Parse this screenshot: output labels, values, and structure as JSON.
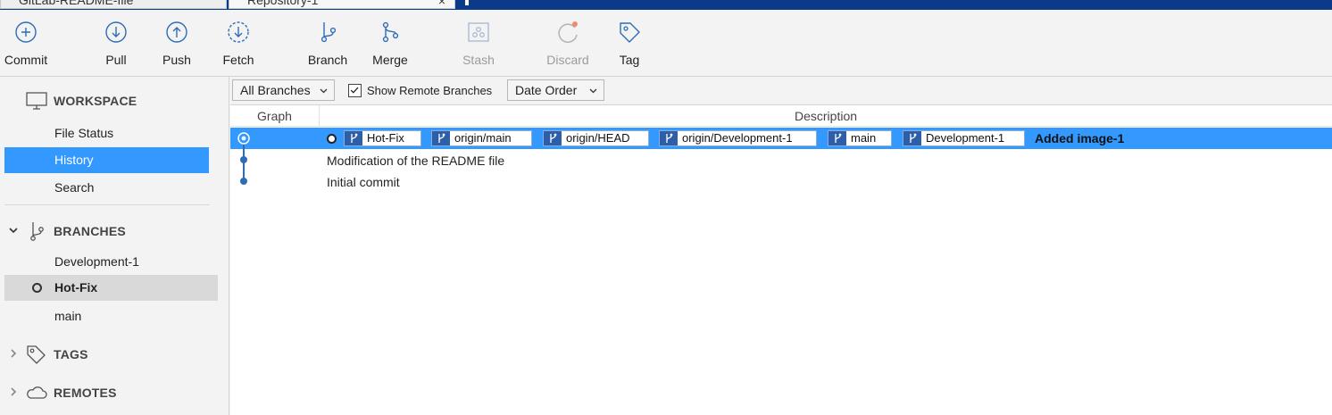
{
  "tabs": [
    {
      "label": "GitLab-README-file"
    },
    {
      "label": "Repository-1",
      "close": "×"
    }
  ],
  "toolbar": {
    "buttons": [
      {
        "label": "Commit",
        "icon": "plus-circle-icon"
      },
      {
        "label": "Pull",
        "icon": "arrow-down-circle-icon"
      },
      {
        "label": "Push",
        "icon": "arrow-up-circle-icon"
      },
      {
        "label": "Fetch",
        "icon": "dashed-arrow-down-circle-icon"
      },
      {
        "label": "Branch",
        "icon": "branch-icon"
      },
      {
        "label": "Merge",
        "icon": "merge-icon"
      },
      {
        "label": "Stash",
        "icon": "stash-icon",
        "disabled": true
      },
      {
        "label": "Discard",
        "icon": "discard-icon",
        "disabled": true
      },
      {
        "label": "Tag",
        "icon": "tag-icon"
      }
    ]
  },
  "sidebar": {
    "workspace": {
      "title": "WORKSPACE",
      "items": [
        {
          "label": "File Status"
        },
        {
          "label": "History",
          "selected": true
        },
        {
          "label": "Search"
        }
      ]
    },
    "branches": {
      "title": "BRANCHES",
      "items": [
        {
          "label": "Development-1"
        },
        {
          "label": "Hot-Fix",
          "current": true
        },
        {
          "label": "main"
        }
      ]
    },
    "tags": {
      "title": "TAGS"
    },
    "remotes": {
      "title": "REMOTES"
    }
  },
  "filters": {
    "branches_select": "All Branches",
    "show_remote_label": "Show Remote Branches",
    "show_remote_checked": true,
    "order_select": "Date Order"
  },
  "columns": {
    "graph": "Graph",
    "description": "Description"
  },
  "commits": [
    {
      "message": "Added image-1",
      "selected": true,
      "refs": [
        "Hot-Fix",
        "origin/main",
        "origin/HEAD",
        "origin/Development-1",
        "main",
        "Development-1"
      ]
    },
    {
      "message": "Modification of the README file"
    },
    {
      "message": "Initial commit"
    }
  ],
  "colors": {
    "accent": "#3399ff",
    "tab_strip": "#0b3a8a",
    "ref_icon": "#2d5ea8",
    "graph_line": "#2d6db5"
  }
}
